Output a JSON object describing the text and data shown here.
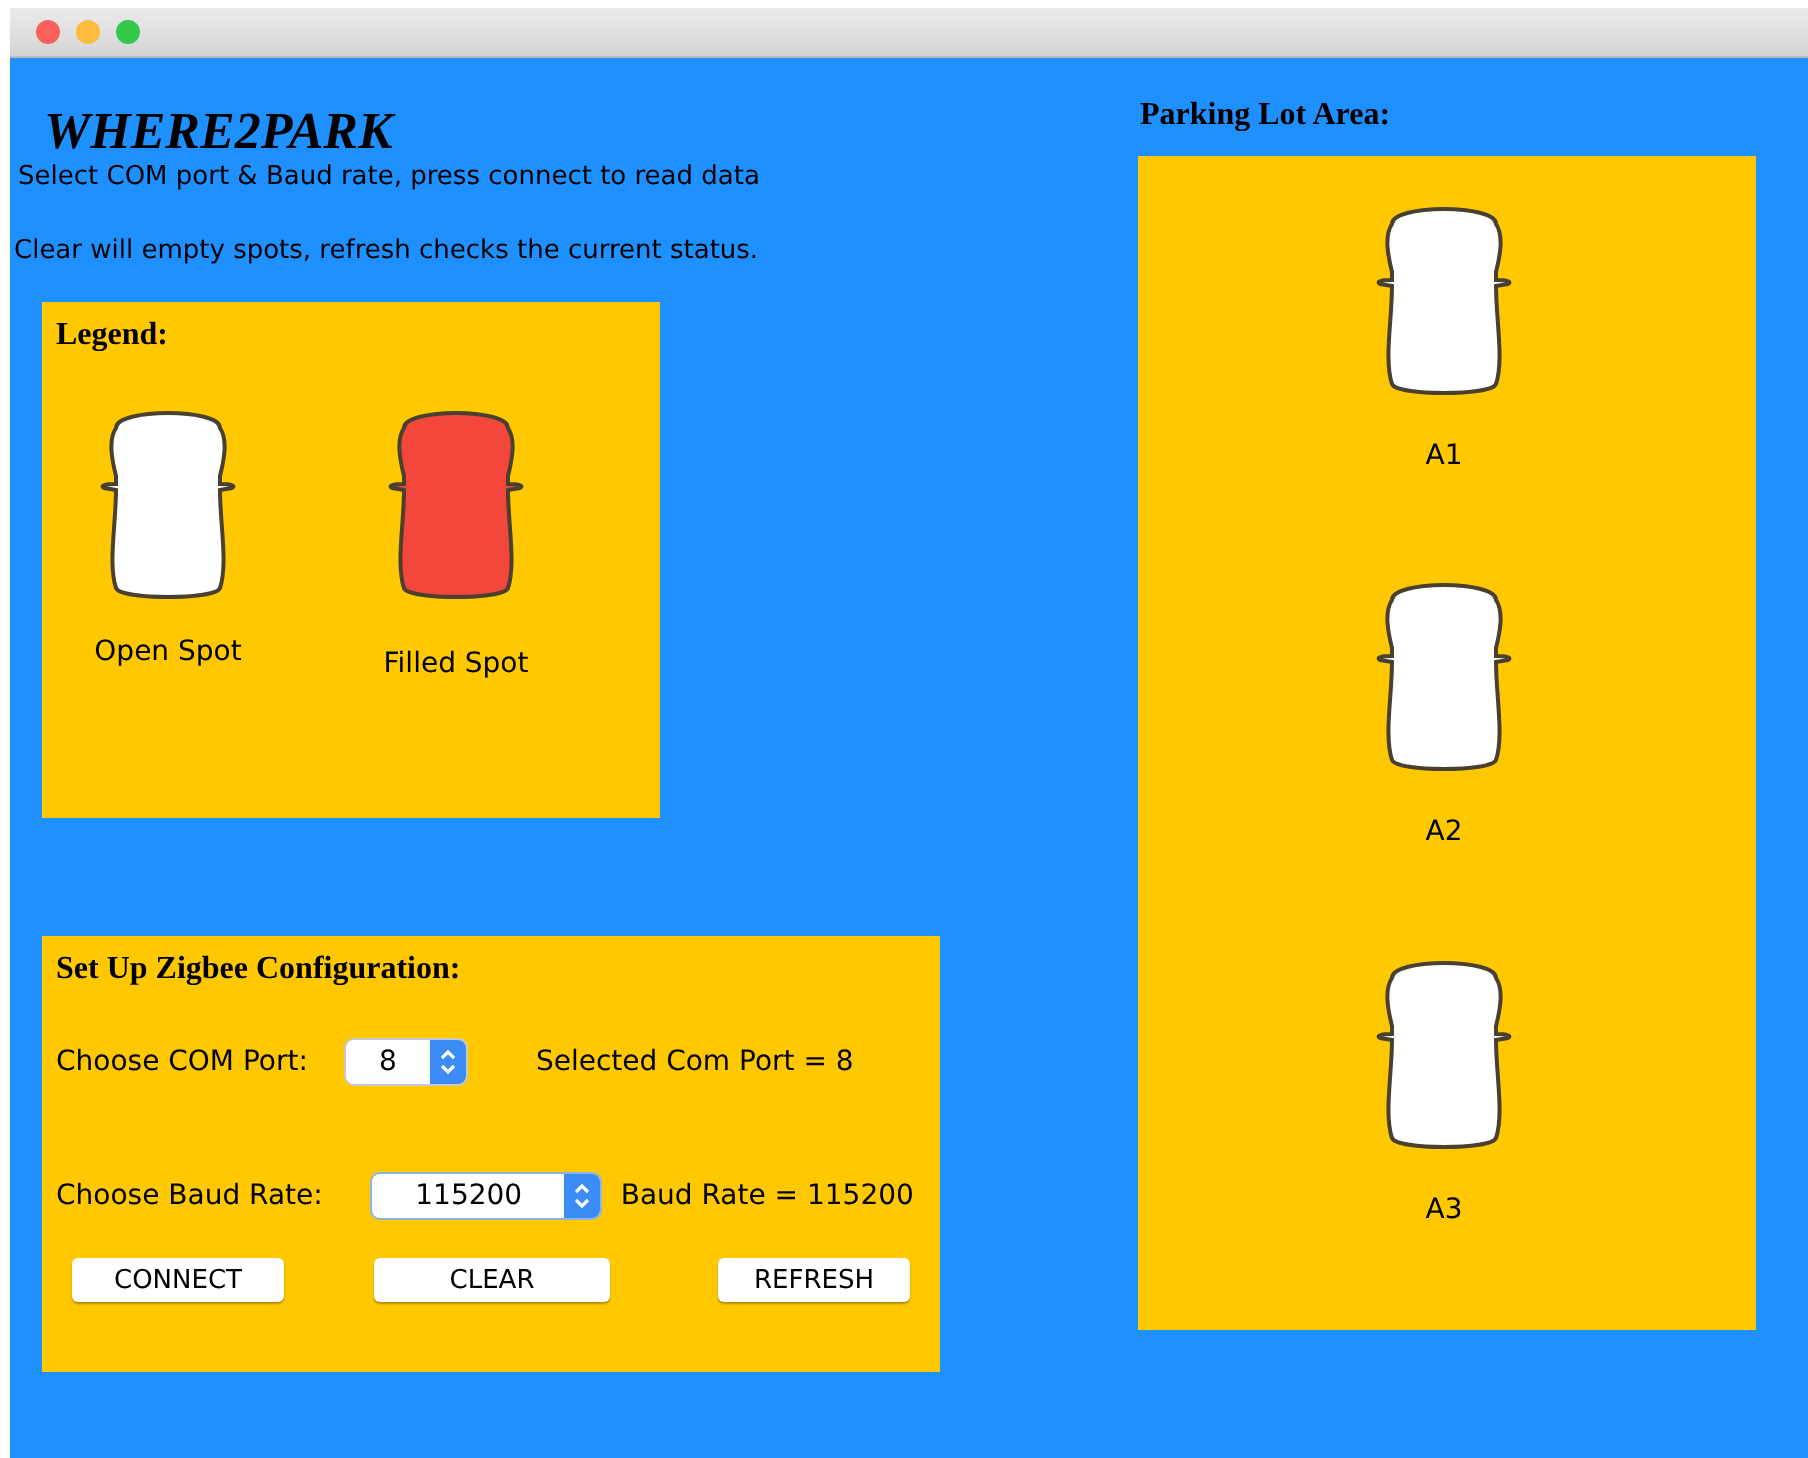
{
  "title": "WHERE2PARK",
  "instructions": [
    "Select COM port & Baud rate, press connect to read data",
    "Clear will empty spots, refresh checks the current status."
  ],
  "legend": {
    "heading": "Legend:",
    "items": [
      {
        "label": "Open Spot",
        "filled": false
      },
      {
        "label": "Filled Spot",
        "filled": true
      }
    ]
  },
  "config": {
    "heading": "Set Up Zigbee Configuration:",
    "com_port": {
      "label": "Choose COM Port:",
      "value": "8",
      "reading": "Selected Com Port = 8"
    },
    "baud_rate": {
      "label": "Choose Baud Rate:",
      "value": "115200",
      "reading": "Baud Rate = 115200"
    },
    "buttons": [
      "CONNECT",
      "CLEAR",
      "REFRESH"
    ]
  },
  "parking_lot": {
    "heading": "Parking Lot Area:",
    "spots": [
      {
        "label": "A1",
        "filled": false
      },
      {
        "label": "A2",
        "filled": false
      },
      {
        "label": "A3",
        "filled": false
      }
    ]
  }
}
